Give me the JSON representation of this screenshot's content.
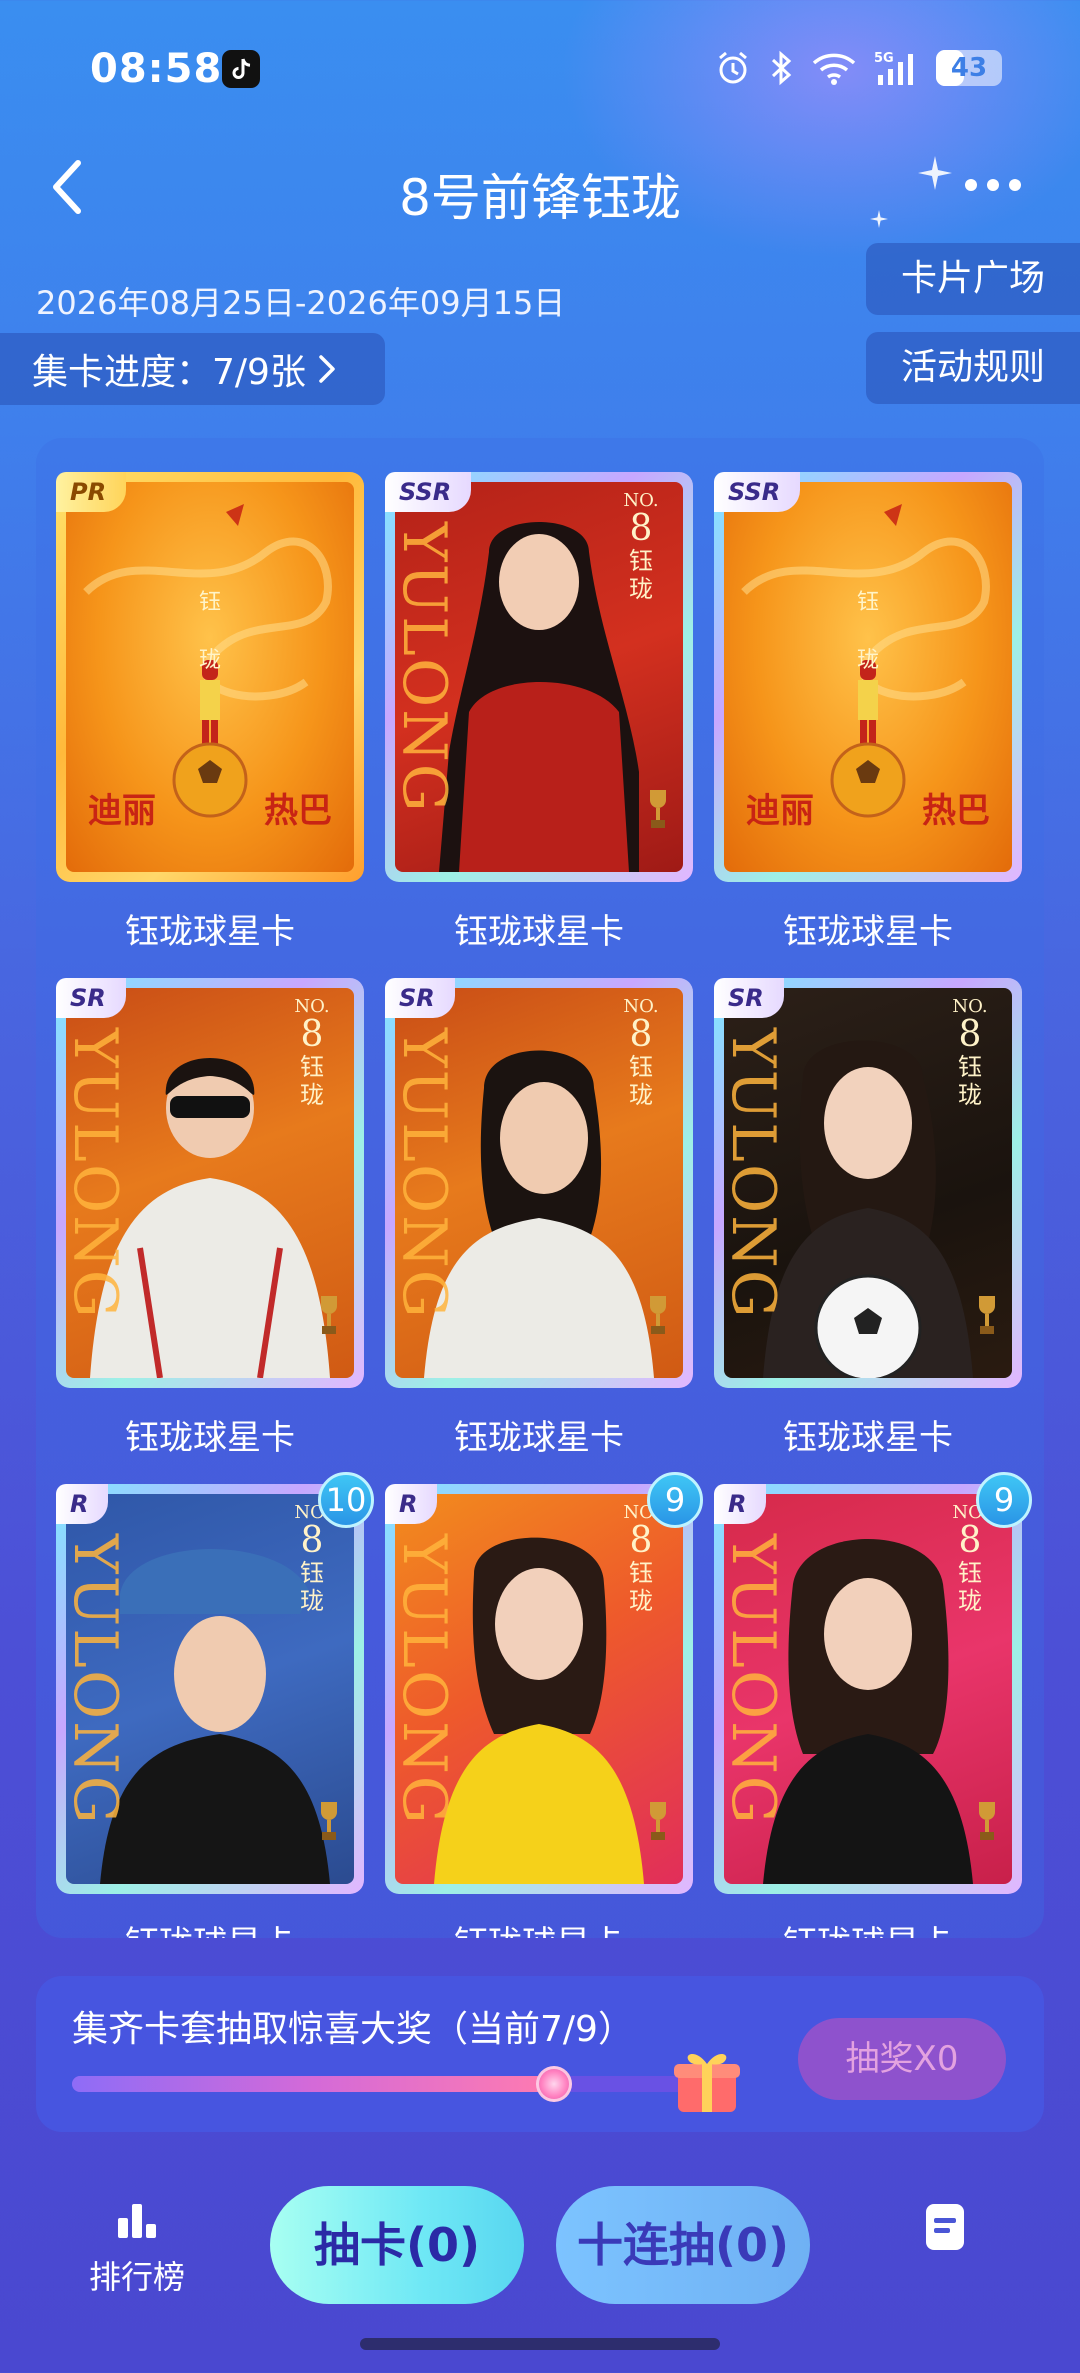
{
  "status_bar": {
    "time": "08:58",
    "battery_text": "43",
    "battery_level": 0.43
  },
  "header": {
    "title": "8号前锋钰珑"
  },
  "event": {
    "date_range": "2026年08月25日-2026年09月15日",
    "progress_label": "集卡进度：7/9张",
    "card_plaza_label": "卡片广场",
    "rules_label": "活动规则"
  },
  "cards": [
    {
      "rarity": "PR",
      "label": "钰珑球星卡",
      "count": null
    },
    {
      "rarity": "SSR",
      "label": "钰珑球星卡",
      "count": null
    },
    {
      "rarity": "SSR",
      "label": "钰珑球星卡",
      "count": null
    },
    {
      "rarity": "SR",
      "label": "钰珑球星卡",
      "count": null
    },
    {
      "rarity": "SR",
      "label": "钰珑球星卡",
      "count": null
    },
    {
      "rarity": "SR",
      "label": "钰珑球星卡",
      "count": null
    },
    {
      "rarity": "R",
      "label": "钰珑球星卡",
      "count": "10"
    },
    {
      "rarity": "R",
      "label": "钰珑球星卡",
      "count": "9"
    },
    {
      "rarity": "R",
      "label": "钰珑球星卡",
      "count": "9"
    }
  ],
  "card_art": {
    "pr_top": "钰",
    "pr_top2": "珑",
    "pr_left": "迪丽",
    "pr_right": "热巴",
    "yulong": "YULONG",
    "no": "NO.",
    "no_number": "8",
    "no_name1": "钰",
    "no_name2": "珑"
  },
  "prize": {
    "title": "集齐卡套抽取惊喜大奖（当前7/9）",
    "progress": 0.778,
    "button_label": "抽奖X0"
  },
  "bottom_bar": {
    "ranking_label": "排行榜",
    "draw_label": "抽卡(0)",
    "ten_draw_label": "十连抽(0)"
  }
}
